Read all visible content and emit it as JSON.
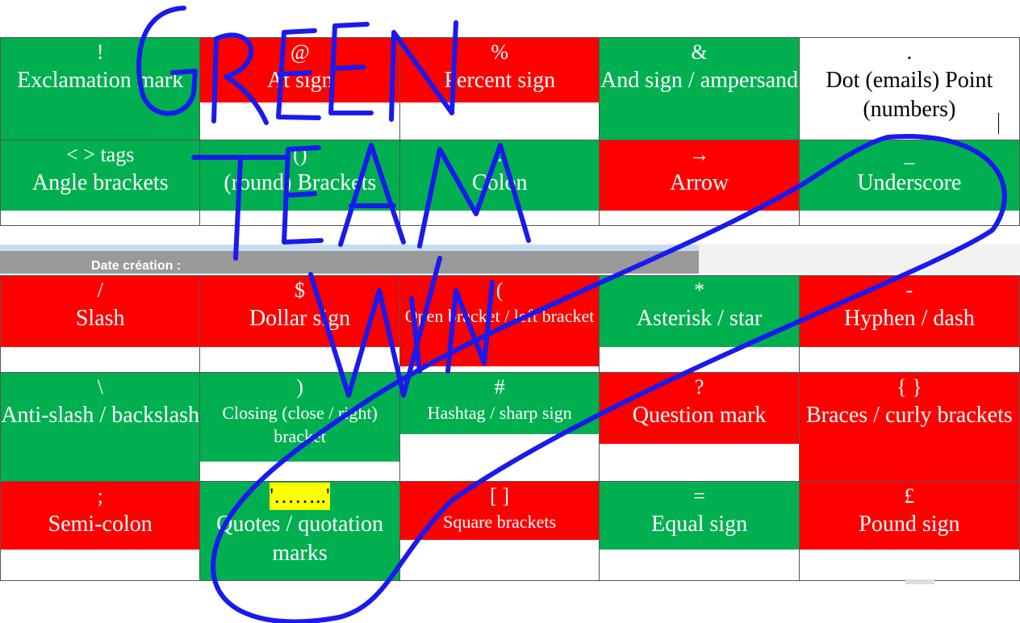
{
  "top_rows": [
    [
      {
        "symbol": "!",
        "name": "Exclamation mark",
        "color": "#00b050",
        "name_size": "normal"
      },
      {
        "symbol": "@",
        "name": "At sign",
        "color": "#ff0000",
        "name_size": "normal"
      },
      {
        "symbol": "%",
        "name": "Percent sign",
        "color": "#ff0000",
        "name_size": "normal"
      },
      {
        "symbol": "&",
        "name": "And sign / ampersand",
        "color": "#00b050",
        "name_size": "normal"
      },
      {
        "symbol": ".",
        "name": "Dot (emails) Point (numbers)",
        "color": "#ffffff",
        "name_size": "normal"
      }
    ],
    [
      {
        "symbol": "< > tags",
        "name": "Angle brackets",
        "color": "#00b050",
        "name_size": "normal"
      },
      {
        "symbol": "()",
        "name": "(round) Brackets",
        "color": "#00b050",
        "name_size": "normal"
      },
      {
        "symbol": ":",
        "name": "Colon",
        "color": "#00b050",
        "name_size": "normal"
      },
      {
        "symbol": "→",
        "name": "Arrow",
        "color": "#ff0000",
        "name_size": "normal"
      },
      {
        "symbol": "_",
        "name": "Underscore",
        "color": "#00b050",
        "name_size": "normal"
      }
    ]
  ],
  "date_bar": {
    "label": "Date création :"
  },
  "bottom_rows": [
    [
      {
        "symbol": "/",
        "name": "Slash",
        "color": "#ff0000",
        "name_size": "normal"
      },
      {
        "symbol": "$",
        "name": "Dollar sign",
        "color": "#ff0000",
        "name_size": "normal"
      },
      {
        "symbol": "(",
        "name": "Open bracket / left bracket",
        "color": "#ff0000",
        "name_size": "small"
      },
      {
        "symbol": "*",
        "name": "Asterisk / star",
        "color": "#00b050",
        "name_size": "normal"
      },
      {
        "symbol": "-",
        "name": "Hyphen / dash",
        "color": "#ff0000",
        "name_size": "normal"
      }
    ],
    [
      {
        "symbol": "\\",
        "name": "Anti-slash / backslash",
        "color": "#00b050",
        "name_size": "normal"
      },
      {
        "symbol": ")",
        "name": "Closing (close / right) bracket",
        "color": "#00b050",
        "name_size": "small"
      },
      {
        "symbol": "#",
        "name": "Hashtag / sharp sign",
        "color": "#00b050",
        "name_size": "small"
      },
      {
        "symbol": "?",
        "name": "Question mark",
        "color": "#ff0000",
        "name_size": "normal"
      },
      {
        "symbol": "{ }",
        "name": "Braces / curly brackets",
        "color": "#ff0000",
        "name_size": "normal"
      }
    ],
    [
      {
        "symbol": ";",
        "name": "Semi-colon",
        "color": "#ff0000",
        "name_size": "normal"
      },
      {
        "symbol": "'……..'",
        "name": "Quotes / quotation marks",
        "color": "#00b050",
        "name_size": "normal"
      },
      {
        "symbol": "[ ]",
        "name": "Square brackets",
        "color": "#ff0000",
        "name_size": "small"
      },
      {
        "symbol": "=",
        "name": "Equal sign",
        "color": "#00b050",
        "name_size": "normal"
      },
      {
        "symbol": "£",
        "name": "Pound sign",
        "color": "#ff0000",
        "name_size": "normal"
      }
    ]
  ],
  "annotation": {
    "text": "GREEN TEAM WIN",
    "ink_color": "#1a1aee"
  }
}
